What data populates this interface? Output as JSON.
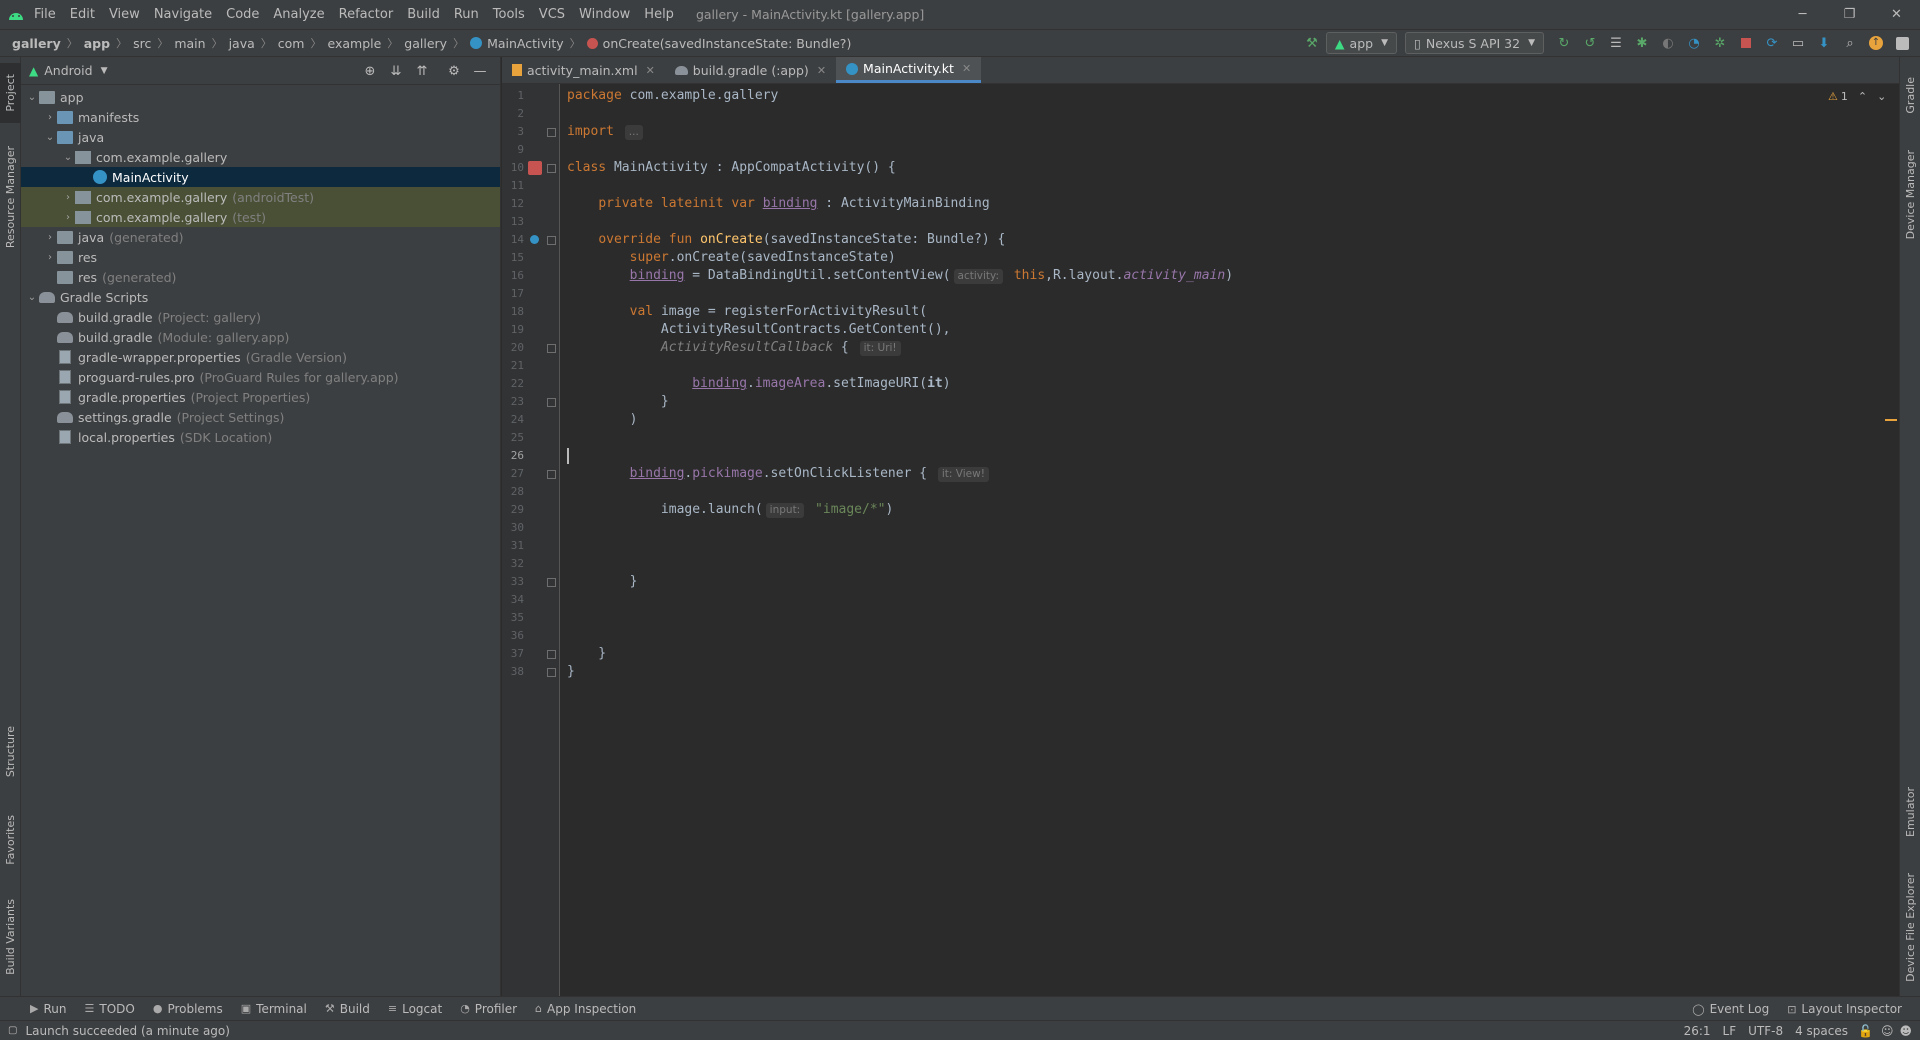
{
  "window": {
    "title": "gallery - MainActivity.kt [gallery.app]",
    "menu": [
      "File",
      "Edit",
      "View",
      "Navigate",
      "Code",
      "Analyze",
      "Refactor",
      "Build",
      "Run",
      "Tools",
      "VCS",
      "Window",
      "Help"
    ]
  },
  "navbar": {
    "breadcrumbs": [
      "gallery",
      "app",
      "src",
      "main",
      "java",
      "com",
      "example",
      "gallery",
      "MainActivity",
      "onCreate(savedInstanceState: Bundle?)"
    ],
    "run_config": "app",
    "device": "Nexus S API 32"
  },
  "project_panel": {
    "view_selector": "Android",
    "tree": [
      {
        "label": "app",
        "secondary": "",
        "indent": 0,
        "expand": "open",
        "icon": "folder"
      },
      {
        "label": "manifests",
        "secondary": "",
        "indent": 1,
        "expand": "closed",
        "icon": "folder-blue"
      },
      {
        "label": "java",
        "secondary": "",
        "indent": 1,
        "expand": "open",
        "icon": "folder-blue"
      },
      {
        "label": "com.example.gallery",
        "secondary": "",
        "indent": 2,
        "expand": "open",
        "icon": "package"
      },
      {
        "label": "MainActivity",
        "secondary": "",
        "indent": 3,
        "expand": "none",
        "icon": "kotlin-class",
        "state": "selected"
      },
      {
        "label": "com.example.gallery",
        "secondary": "(androidTest)",
        "indent": 2,
        "expand": "closed",
        "icon": "package",
        "state": "highlight"
      },
      {
        "label": "com.example.gallery",
        "secondary": "(test)",
        "indent": 2,
        "expand": "closed",
        "icon": "package",
        "state": "highlight"
      },
      {
        "label": "java",
        "secondary": "(generated)",
        "indent": 1,
        "expand": "closed",
        "icon": "folder"
      },
      {
        "label": "res",
        "secondary": "",
        "indent": 1,
        "expand": "closed",
        "icon": "folder"
      },
      {
        "label": "res",
        "secondary": "(generated)",
        "indent": 1,
        "expand": "none",
        "icon": "folder"
      },
      {
        "label": "Gradle Scripts",
        "secondary": "",
        "indent": 0,
        "expand": "open",
        "icon": "gradle"
      },
      {
        "label": "build.gradle",
        "secondary": "(Project: gallery)",
        "indent": 1,
        "expand": "none",
        "icon": "gradle"
      },
      {
        "label": "build.gradle",
        "secondary": "(Module: gallery.app)",
        "indent": 1,
        "expand": "none",
        "icon": "gradle"
      },
      {
        "label": "gradle-wrapper.properties",
        "secondary": "(Gradle Version)",
        "indent": 1,
        "expand": "none",
        "icon": "properties"
      },
      {
        "label": "proguard-rules.pro",
        "secondary": "(ProGuard Rules for gallery.app)",
        "indent": 1,
        "expand": "none",
        "icon": "properties"
      },
      {
        "label": "gradle.properties",
        "secondary": "(Project Properties)",
        "indent": 1,
        "expand": "none",
        "icon": "properties"
      },
      {
        "label": "settings.gradle",
        "secondary": "(Project Settings)",
        "indent": 1,
        "expand": "none",
        "icon": "gradle"
      },
      {
        "label": "local.properties",
        "secondary": "(SDK Location)",
        "indent": 1,
        "expand": "none",
        "icon": "properties"
      }
    ]
  },
  "left_tool_tabs": [
    "Project",
    "Resource Manager",
    "Structure",
    "Favorites",
    "Build Variants"
  ],
  "right_tool_tabs": [
    "Gradle",
    "Device Manager",
    "Emulator",
    "Device File Explorer"
  ],
  "editor": {
    "tabs": [
      {
        "label": "activity_main.xml",
        "active": false
      },
      {
        "label": "build.gradle (:app)",
        "active": false
      },
      {
        "label": "MainActivity.kt",
        "active": true
      }
    ],
    "warnings": "1",
    "current_line": 26,
    "lines": [
      {
        "n": "1",
        "html": "<span class='kw'>package </span>com.example.gallery"
      },
      {
        "n": "2",
        "html": ""
      },
      {
        "n": "3",
        "html": "<span class='kw'>import </span><span class='hint'>...</span>"
      },
      {
        "n": "9",
        "html": ""
      },
      {
        "n": "10",
        "html": "<span class='kw'>class </span>MainActivity : AppCompatActivity() {"
      },
      {
        "n": "11",
        "html": ""
      },
      {
        "n": "12",
        "html": "    <span class='kw'>private lateinit var </span><span class='und'>binding</span> : ActivityMainBinding"
      },
      {
        "n": "13",
        "html": ""
      },
      {
        "n": "14",
        "html": "    <span class='kw'>override fun </span><span class='fn'>onCreate</span>(savedInstanceState: Bundle?) {"
      },
      {
        "n": "15",
        "html": "        <span class='kw'>super</span>.onCreate(savedInstanceState)"
      },
      {
        "n": "16",
        "html": "        <span class='und'>binding</span> = DataBindingUtil.setContentView(<span class='hint'>activity:</span> <span class='kw'>this</span>,R.layout.<span class='it'>activity_main</span>)"
      },
      {
        "n": "17",
        "html": ""
      },
      {
        "n": "18",
        "html": "        <span class='kw'>val </span>image = registerForActivityResult("
      },
      {
        "n": "19",
        "html": "            ActivityResultContracts.GetContent(),"
      },
      {
        "n": "20",
        "html": "            <span class='cm'>ActivityResultCallback</span> { <span class='hint'>it: Uri!</span>"
      },
      {
        "n": "21",
        "html": ""
      },
      {
        "n": "22",
        "html": "                <span class='und'>binding</span>.<span class='prop'>imageArea</span>.setImageURI(<span style='font-weight:bold'>it</span>)"
      },
      {
        "n": "23",
        "html": "            }"
      },
      {
        "n": "24",
        "html": "        )"
      },
      {
        "n": "25",
        "html": ""
      },
      {
        "n": "26",
        "html": ""
      },
      {
        "n": "27",
        "html": "        <span class='und'>binding</span>.<span class='prop'>pickimage</span>.setOnClickListener { <span class='hint'>it: View!</span>"
      },
      {
        "n": "28",
        "html": ""
      },
      {
        "n": "29",
        "html": "            image.launch(<span class='hint'>input:</span> <span class='str'>\"image/*\"</span>)"
      },
      {
        "n": "30",
        "html": ""
      },
      {
        "n": "31",
        "html": ""
      },
      {
        "n": "32",
        "html": ""
      },
      {
        "n": "33",
        "html": "        }"
      },
      {
        "n": "34",
        "html": ""
      },
      {
        "n": "35",
        "html": ""
      },
      {
        "n": "36",
        "html": ""
      },
      {
        "n": "37",
        "html": "    }"
      },
      {
        "n": "38",
        "html": "}"
      }
    ]
  },
  "bottom_tabs": {
    "left": [
      "Run",
      "TODO",
      "Problems",
      "Terminal",
      "Build",
      "Logcat",
      "Profiler",
      "App Inspection"
    ],
    "right": [
      "Event Log",
      "Layout Inspector"
    ]
  },
  "status": {
    "message": "Launch succeeded (a minute ago)",
    "position": "26:1",
    "line_sep": "LF",
    "encoding": "UTF-8",
    "indent": "4 spaces"
  },
  "colors": {
    "accent": "#4a88c7",
    "selection": "#0d293e",
    "keyword": "#cc7832"
  }
}
